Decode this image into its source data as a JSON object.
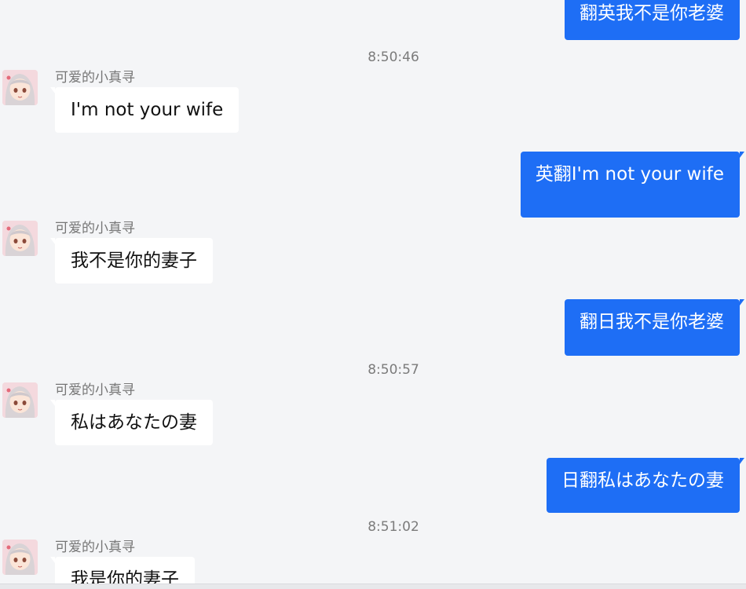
{
  "messages": [
    {
      "side": "right",
      "text": "翻英我不是你老婆"
    },
    {
      "side": "time",
      "text": "8:50:46"
    },
    {
      "side": "left",
      "name": "可爱的小真寻",
      "text": "I'm not your wife"
    },
    {
      "side": "right",
      "text": "英翻I'm not your wife"
    },
    {
      "side": "left",
      "name": "可爱的小真寻",
      "text": "我不是你的妻子"
    },
    {
      "side": "right",
      "text": "翻日我不是你老婆"
    },
    {
      "side": "time",
      "text": "8:50:57"
    },
    {
      "side": "left",
      "name": "可爱的小真寻",
      "text": "私はあなたの妻"
    },
    {
      "side": "right",
      "text": "日翻私はあなたの妻"
    },
    {
      "side": "time",
      "text": "8:51:02"
    },
    {
      "side": "left",
      "name": "可爱的小真寻",
      "text": "我是你的妻子"
    }
  ],
  "icons": {
    "avatar": "anime-girl-avatar-icon"
  },
  "colors": {
    "background": "#f4f5f7",
    "self_bubble": "#1e6ef5",
    "other_bubble": "#ffffff",
    "timestamp": "#7b7b7b"
  }
}
